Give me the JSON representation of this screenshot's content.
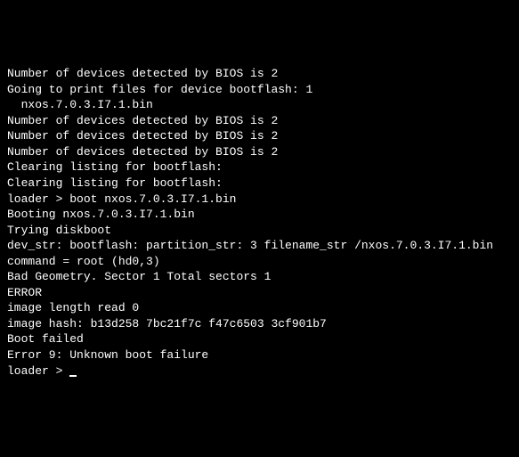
{
  "terminal": {
    "lines": [
      "Number of devices detected by BIOS is 2",
      "Going to print files for device bootflash: 1",
      "  nxos.7.0.3.I7.1.bin",
      "Number of devices detected by BIOS is 2",
      "Number of devices detected by BIOS is 2",
      "Number of devices detected by BIOS is 2",
      "Clearing listing for bootflash:",
      "Clearing listing for bootflash:",
      "",
      "loader > boot nxos.7.0.3.I7.1.bin",
      "Booting nxos.7.0.3.I7.1.bin",
      "Trying diskboot",
      "dev_str: bootflash: partition_str: 3 filename_str /nxos.7.0.3.I7.1.bin",
      "command = root (hd0,3)",
      "Bad Geometry. Sector 1 Total sectors 1",
      "ERROR",
      "",
      "image length read 0",
      "",
      "image hash: b13d258 7bc21f7c f47c6503 3cf901b7",
      "Boot failed",
      "",
      "Error 9: Unknown boot failure",
      "",
      "loader > "
    ],
    "prompt_index": 24
  }
}
